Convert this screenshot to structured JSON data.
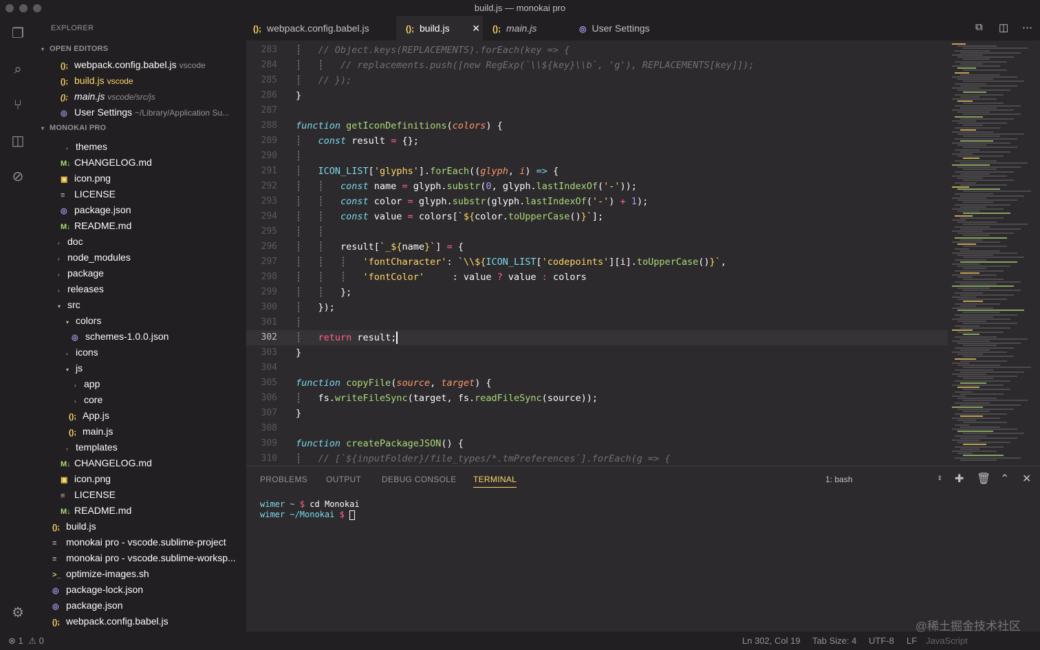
{
  "window": {
    "title": "build.js — monokai pro"
  },
  "sidebar": {
    "title": "EXPLORER",
    "open_editors_label": "OPEN EDITORS",
    "open_editors": [
      {
        "icon": "(); ",
        "name": "webpack.config.babel.js",
        "hint": "vscode"
      },
      {
        "icon": "(); ",
        "name": "build.js",
        "hint": "vscode"
      },
      {
        "icon": "(); ",
        "name": "main.js",
        "hint": "vscode/src/js"
      },
      {
        "icon": "◎",
        "name": "User Settings",
        "hint": "~/Library/Application Su..."
      }
    ],
    "project_label": "MONOKAI PRO",
    "tree": [
      {
        "name": "themes",
        "icon": "›"
      },
      {
        "name": "CHANGELOG.md",
        "icon": "M↓"
      },
      {
        "name": "icon.png",
        "icon": "▣"
      },
      {
        "name": "LICENSE",
        "icon": "≡"
      },
      {
        "name": "package.json",
        "icon": "◎"
      },
      {
        "name": "README.md",
        "icon": "M↓"
      },
      {
        "name": "doc",
        "icon": "›"
      },
      {
        "name": "node_modules",
        "icon": "›"
      },
      {
        "name": "package",
        "icon": "›"
      },
      {
        "name": "releases",
        "icon": "›"
      },
      {
        "name": "src",
        "icon": "▾"
      },
      {
        "name": "colors",
        "icon": "▾"
      },
      {
        "name": "schemes-1.0.0.json",
        "icon": "◎"
      },
      {
        "name": "icons",
        "icon": "›"
      },
      {
        "name": "js",
        "icon": "▾"
      },
      {
        "name": "app",
        "icon": "›"
      },
      {
        "name": "core",
        "icon": "›"
      },
      {
        "name": "App.js",
        "icon": "();"
      },
      {
        "name": "main.js",
        "icon": "();"
      },
      {
        "name": "templates",
        "icon": "›"
      },
      {
        "name": "CHANGELOG.md",
        "icon": "M↓"
      },
      {
        "name": "icon.png",
        "icon": "▣"
      },
      {
        "name": "LICENSE",
        "icon": "≡"
      },
      {
        "name": "README.md",
        "icon": "M↓"
      },
      {
        "name": "build.js",
        "icon": "();"
      },
      {
        "name": "monokai pro - vscode.sublime-project",
        "icon": "≡"
      },
      {
        "name": "monokai pro - vscode.sublime-worksp...",
        "icon": "≡"
      },
      {
        "name": "optimize-images.sh",
        "icon": ">_"
      },
      {
        "name": "package-lock.json",
        "icon": "◎"
      },
      {
        "name": "package.json",
        "icon": "◎"
      },
      {
        "name": "webpack.config.babel.js",
        "icon": "();"
      }
    ]
  },
  "tabs": [
    {
      "icon": "();",
      "label": "webpack.config.babel.js"
    },
    {
      "icon": "();",
      "label": "build.js"
    },
    {
      "icon": "();",
      "label": "main.js"
    },
    {
      "icon": "◎",
      "label": "User Settings"
    }
  ],
  "editor": {
    "line_numbers": [
      "283",
      "284",
      "285",
      "286",
      "287",
      "288",
      "289",
      "290",
      "291",
      "292",
      "293",
      "294",
      "295",
      "296",
      "297",
      "298",
      "299",
      "300",
      "301",
      "302",
      "303",
      "304",
      "305",
      "306",
      "307",
      "308",
      "309",
      "310"
    ]
  },
  "panel": {
    "tabs": [
      "PROBLEMS",
      "OUTPUT",
      "DEBUG CONSOLE",
      "TERMINAL"
    ],
    "terminal_select": "1: bash",
    "terminal": [
      {
        "user": "wimer",
        "path": "~",
        "cmd": "cd Monokai"
      },
      {
        "user": "wimer",
        "path": "~/Monokai",
        "cmd": ""
      }
    ]
  },
  "statusbar": {
    "errors": "1",
    "warnings": "0",
    "position": "Ln 302, Col 19",
    "tab_size": "Tab Size: 4",
    "encoding": "UTF-8",
    "eol": "LF",
    "language": "JavaScript"
  },
  "watermark": "@稀土掘金技术社区",
  "colors": {
    "accent": "#ffd866",
    "background": "#2d2a2e",
    "sidebar": "#221f22"
  }
}
